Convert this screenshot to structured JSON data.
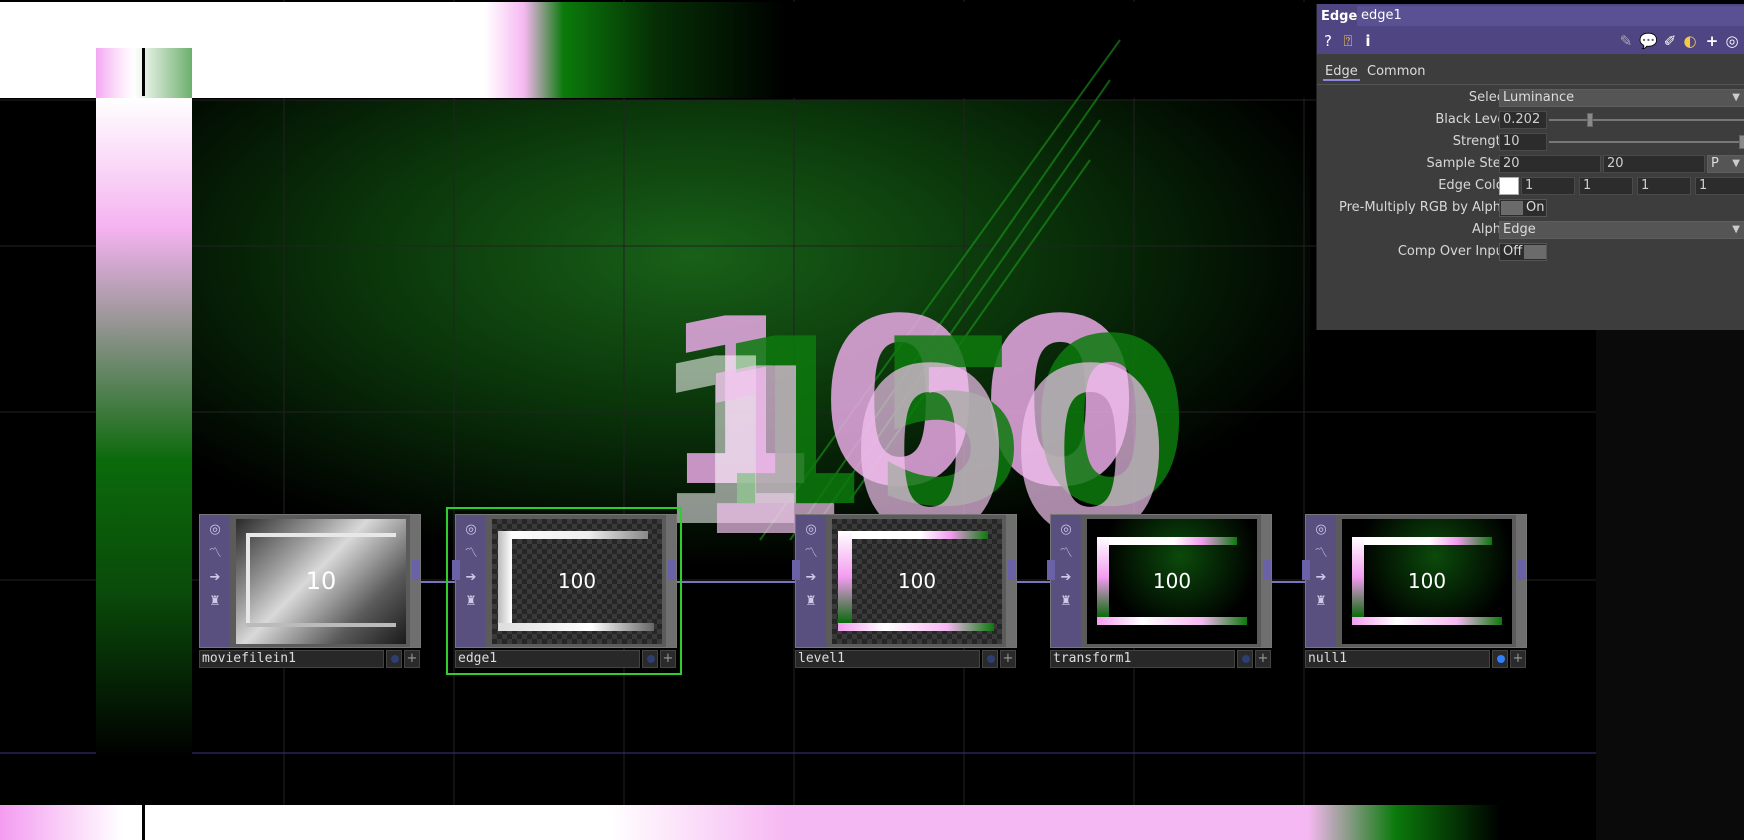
{
  "panel": {
    "op_type": "Edge",
    "op_name": "edge1",
    "tabs": [
      "Edge",
      "Common"
    ],
    "params": {
      "select": {
        "label": "Select",
        "value": "Luminance"
      },
      "black_level": {
        "label": "Black Level",
        "value": "0.202",
        "fraction": 0.2
      },
      "strength": {
        "label": "Strength",
        "value": "10",
        "fraction": 1.0
      },
      "sample_step": {
        "label": "Sample Step",
        "x": "20",
        "y": "20",
        "unit": "P"
      },
      "edge_color": {
        "label": "Edge Color",
        "swatch": "#ffffff",
        "r": "1",
        "g": "1",
        "b": "1",
        "a": "1"
      },
      "premultiply": {
        "label": "Pre-Multiply RGB by Alpha",
        "value": "On"
      },
      "alpha": {
        "label": "Alpha",
        "value": "Edge"
      },
      "comp_over_input": {
        "label": "Comp Over Input",
        "value": "Off"
      }
    }
  },
  "nodes": [
    {
      "name": "moviefilein1",
      "thumb_text": "10"
    },
    {
      "name": "edge1",
      "thumb_text": "100",
      "selected": true
    },
    {
      "name": "level1",
      "thumb_text": "100"
    },
    {
      "name": "transform1",
      "thumb_text": "100"
    },
    {
      "name": "null1",
      "thumb_text": "100"
    }
  ],
  "background_digits": [
    "100",
    "150",
    "1",
    "100"
  ],
  "icons": {
    "node_sidebar": [
      "viewer-icon",
      "bypass-icon",
      "export-icon",
      "lock-icon"
    ],
    "panel_toolbar": [
      "help-icon",
      "operator-help-icon",
      "info-icon",
      "edit-icon",
      "comment-icon",
      "docked-icon",
      "python-icon",
      "add-icon",
      "target-icon"
    ]
  },
  "colors": {
    "selection": "#2ccf2c",
    "node_sidebar": "#5a5080",
    "panel_header": "#4e4582",
    "pink": "#f39cf0",
    "green": "#0b7a0b"
  }
}
